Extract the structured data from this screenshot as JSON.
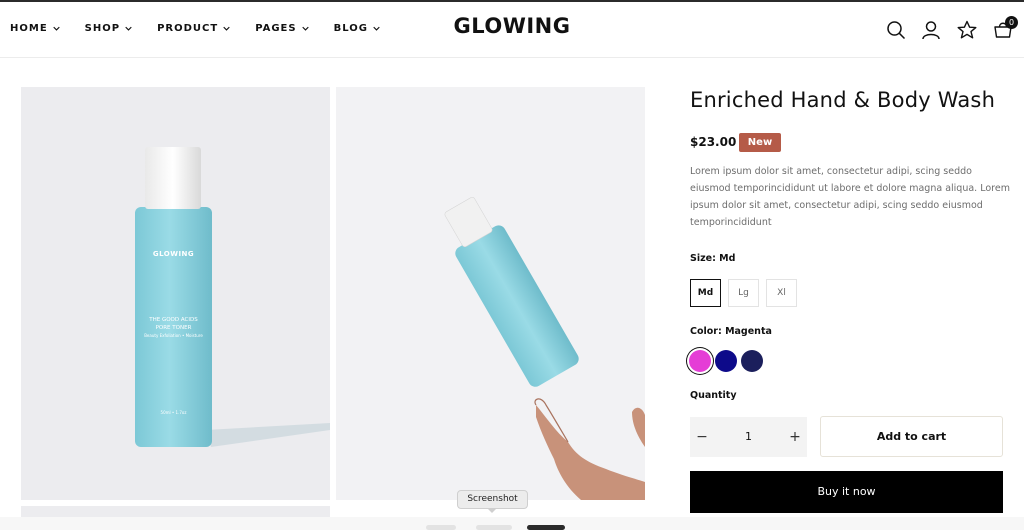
{
  "brand": "GLOWING",
  "nav": [
    {
      "label": "HOME"
    },
    {
      "label": "SHOP"
    },
    {
      "label": "PRODUCT"
    },
    {
      "label": "PAGES"
    },
    {
      "label": "BLOG"
    }
  ],
  "header_icons": {
    "search": "search-icon",
    "account": "user-icon",
    "wishlist": "star-icon",
    "cart": "cart-icon",
    "cart_count": "0"
  },
  "bottle": {
    "brand": "GLOWING",
    "line1": "THE GOOD ACIDS",
    "line2": "PORE TONER",
    "line3": "Beauty Exfoliation • Moisture",
    "volume": "50ml • 1.7oz"
  },
  "product": {
    "title": "Enriched Hand & Body Wash",
    "price": "$23.00",
    "badge": "New",
    "description": "Lorem ipsum dolor sit amet, consectetur adipi, scing seddo eiusmod temporincididunt ut labore et dolore magna aliqua. Lorem ipsum dolor sit amet, consectetur adipi, scing seddo eiusmod temporincididunt",
    "size_label": "Size: Md",
    "sizes": [
      "Md",
      "Lg",
      "Xl"
    ],
    "selected_size": "Md",
    "color_label": "Color: Magenta",
    "colors": [
      {
        "name": "Magenta",
        "hex": "#e53dd6"
      },
      {
        "name": "Navy",
        "hex": "#0d0a8a"
      },
      {
        "name": "Midnight",
        "hex": "#1b1f5c"
      }
    ],
    "quantity_label": "Quantity",
    "quantity": "1",
    "minus": "−",
    "plus": "+",
    "add_to_cart": "Add to cart",
    "buy_now": "Buy it now"
  },
  "tooltip": "Screenshot",
  "colors": {
    "badge": "#b55b48",
    "bottle": "#8fd3e0",
    "buy_now_bg": "#000000"
  }
}
